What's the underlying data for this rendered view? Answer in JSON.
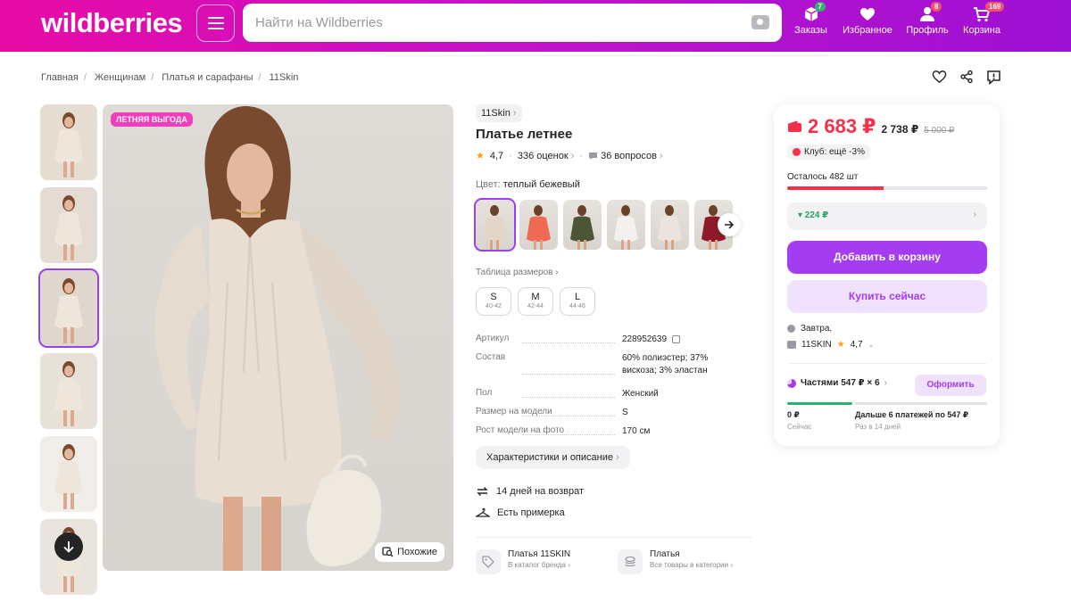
{
  "header": {
    "logo": "wildberries",
    "search_placeholder": "Найти на Wildberries",
    "nav": [
      {
        "label": "Заказы",
        "badge": "7",
        "icon": "box-icon"
      },
      {
        "label": "Избранное",
        "badge": "",
        "icon": "heart-icon"
      },
      {
        "label": "Профиль",
        "badge": "8",
        "icon": "user-icon"
      },
      {
        "label": "Корзина",
        "badge": "169",
        "icon": "cart-icon"
      }
    ]
  },
  "breadcrumbs": [
    "Главная",
    "Женщинам",
    "Платья и сарафаны",
    "11Skin"
  ],
  "gallery": {
    "promo_badge": "ЛЕТНЯЯ ВЫГОДА",
    "similar_label": "Похожие",
    "thumbnail_count": 6,
    "active_thumbnail": 3
  },
  "product": {
    "brand": "11Skin",
    "title": "Платье летнее",
    "rating": "4,7",
    "reviews": "336 оценок",
    "questions": "36 вопросов",
    "color_label": "Цвет:",
    "color_value": "теплый бежевый",
    "colors": [
      "#e3d6c9",
      "#ee6a52",
      "#4c5636",
      "#f2f1ee",
      "#ece4dc",
      "#8e1a2a"
    ],
    "size_table_label": "Таблица размеров",
    "sizes": [
      {
        "size": "S",
        "range": "40-42"
      },
      {
        "size": "M",
        "range": "42-44"
      },
      {
        "size": "L",
        "range": "44-46"
      }
    ],
    "specs": [
      {
        "key": "Артикул",
        "value": "228952639"
      },
      {
        "key": "Состав",
        "value": "60% полиэстер; 37% вискоза; 3% эластан"
      },
      {
        "key": "Пол",
        "value": "Женский"
      },
      {
        "key": "Размер на модели",
        "value": "S"
      },
      {
        "key": "Рост модели на фото",
        "value": "170 см"
      }
    ],
    "characteristics_button": "Характеристики и описание",
    "return_label": "14 дней на возврат",
    "fitting_label": "Есть примерка",
    "brand_link": {
      "title": "Платья 11SKIN",
      "sub": "В каталог бренда"
    },
    "category_link": {
      "title": "Платья",
      "sub": "Все товары в категории"
    }
  },
  "buy_card": {
    "price": "2 683 ₽",
    "wallet_price": "2 738 ₽",
    "old_price": "5 000 ₽",
    "club": "Клуб: ещё -3%",
    "stock": "Осталось 482 шт",
    "stock_fill": 0.48,
    "wallet_bonus": "▾ 224 ₽",
    "add_to_cart": "Добавить в корзину",
    "buy_now": "Купить сейчас",
    "delivery": "Завтра,",
    "seller": "11SKIN",
    "seller_rating": "4,7",
    "installments": "Частями 547 ₽ × 6",
    "installments_button": "Оформить",
    "now_amount": "0 ₽",
    "now_label": "Сейчас",
    "later_amount": "Дальше 6 платежей по 547 ₽",
    "later_label": "Раз в 14 дней"
  },
  "colors": {
    "accent": "#a43cf0",
    "price": "#f5304a",
    "promo": "#f13cbc"
  }
}
